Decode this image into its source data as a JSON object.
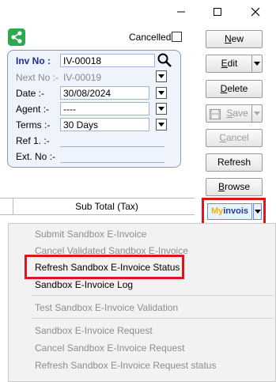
{
  "window": {
    "minimize_glyph": "—",
    "maximize_glyph": "☐",
    "close_glyph": "✕"
  },
  "header": {
    "cancelled_label": "Cancelled"
  },
  "form": {
    "inv_no_label": "Inv No :",
    "inv_no_value": "IV-00018",
    "next_no_label": "Next No :-",
    "next_no_value": "IV-00019",
    "date_label": "Date :-",
    "date_value": "30/08/2024",
    "agent_label": "Agent :-",
    "agent_value": "----",
    "terms_label": "Terms :-",
    "terms_value": "30 Days",
    "ref1_label": "Ref 1. :-",
    "ref1_value": "",
    "extno_label": "Ext. No :-",
    "extno_value": ""
  },
  "buttons": {
    "new_label": "New",
    "edit_label": "Edit",
    "delete_label": "Delete",
    "save_label": "Save",
    "cancel_label": "Cancel",
    "refresh_label": "Refresh",
    "browse_label": "Browse",
    "myinvois_my": "My",
    "myinvois_rest": "invois"
  },
  "grid": {
    "subtotal_header": "Sub Total (Tax)"
  },
  "menu": {
    "items": [
      "Submit Sandbox E-Invoice",
      "Cancel Validated Sandbox E-Invoice",
      "Refresh Sandbox E-Invoice Status",
      "Sandbox E-Invoice Log",
      "Test Sandbox E-Invoice Validation",
      "Sandbox E-Invoice Request",
      "Cancel Sandbox E-Invoice Request",
      "Refresh Sandbox E-Invoice Request status"
    ]
  },
  "colors": {
    "highlight": "#e0141e",
    "share_icon": "#2fa84f",
    "panel_border": "#7a9cd6"
  }
}
